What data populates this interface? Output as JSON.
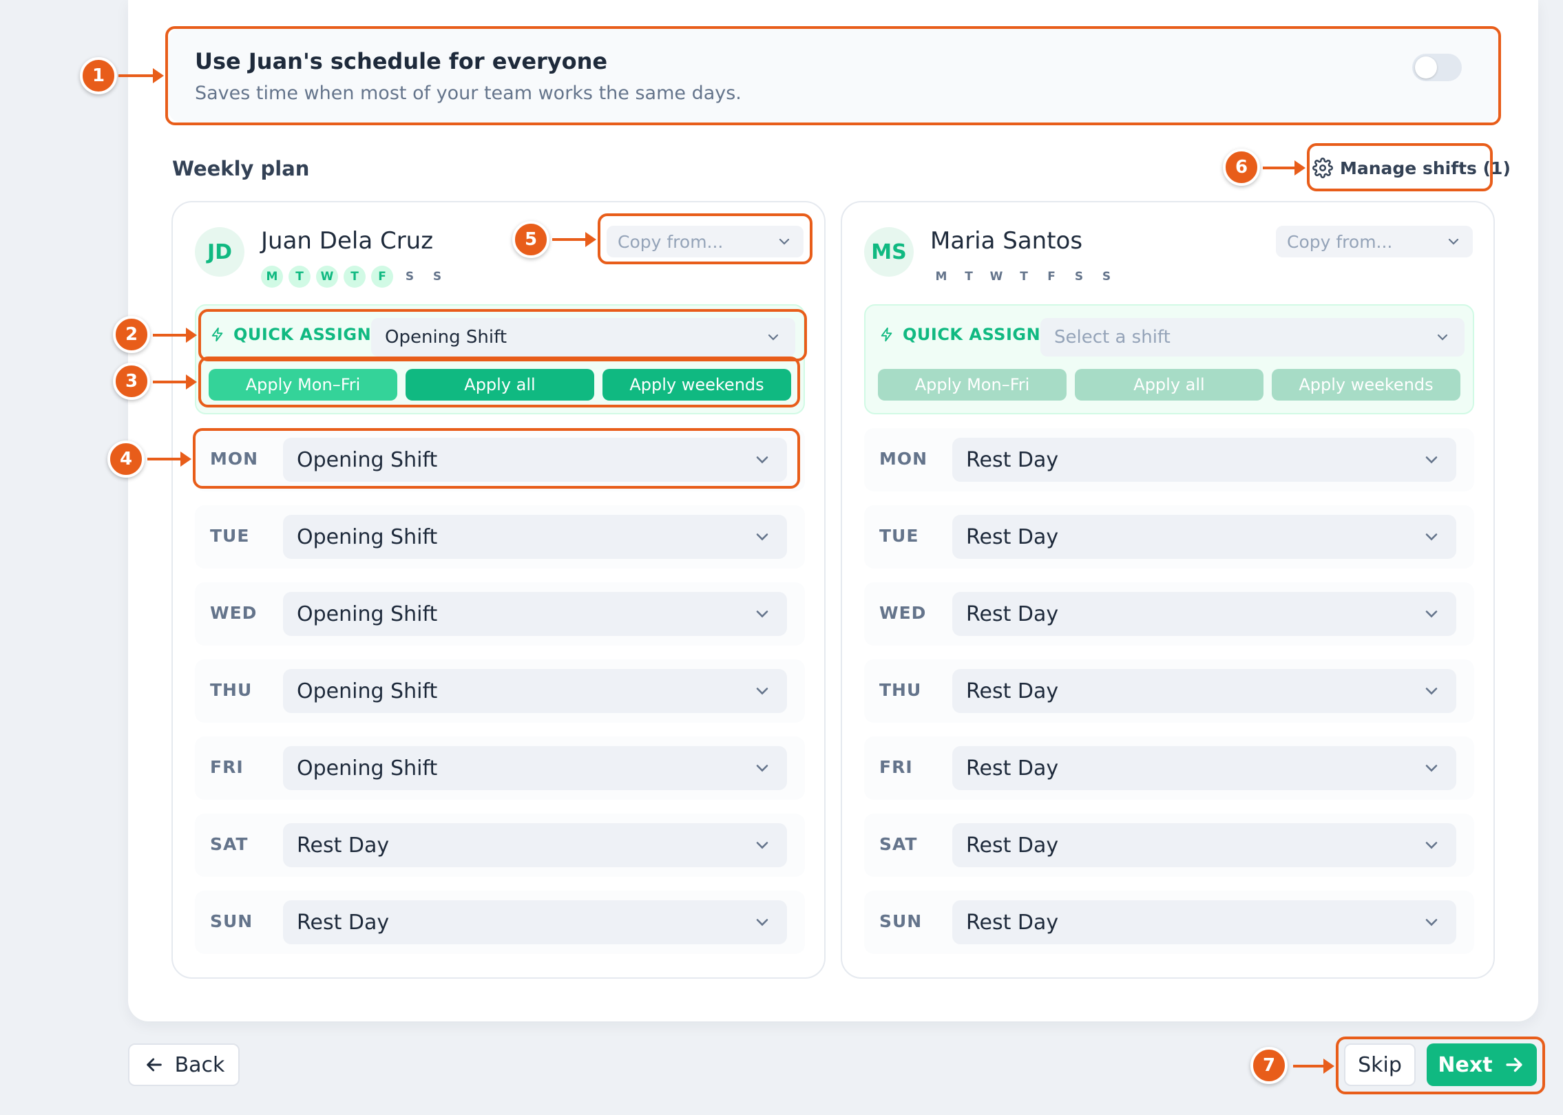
{
  "toggle_section": {
    "title": "Use Juan's schedule for everyone",
    "subtitle": "Saves time when most of your team works the same days.",
    "enabled": false
  },
  "weekly_plan": {
    "title": "Weekly plan",
    "manage_shifts_label": "Manage shifts (1)"
  },
  "employees": [
    {
      "initials": "JD",
      "name": "Juan Dela Cruz",
      "week_days": [
        "M",
        "T",
        "W",
        "T",
        "F",
        "S",
        "S"
      ],
      "copy_from_placeholder": "Copy from...",
      "quick_assign": {
        "label": "QUICK ASSIGN",
        "selected": "Opening Shift",
        "buttons": [
          "Apply Mon–Fri",
          "Apply all",
          "Apply weekends"
        ]
      },
      "schedule": [
        {
          "day": "MON",
          "shift": "Opening Shift"
        },
        {
          "day": "TUE",
          "shift": "Opening Shift"
        },
        {
          "day": "WED",
          "shift": "Opening Shift"
        },
        {
          "day": "THU",
          "shift": "Opening Shift"
        },
        {
          "day": "FRI",
          "shift": "Opening Shift"
        },
        {
          "day": "SAT",
          "shift": "Rest Day"
        },
        {
          "day": "SUN",
          "shift": "Rest Day"
        }
      ]
    },
    {
      "initials": "MS",
      "name": "Maria Santos",
      "week_days": [
        "M",
        "T",
        "W",
        "T",
        "F",
        "S",
        "S"
      ],
      "copy_from_placeholder": "Copy from...",
      "quick_assign": {
        "label": "QUICK ASSIGN",
        "placeholder": "Select a shift",
        "buttons": [
          "Apply Mon–Fri",
          "Apply all",
          "Apply weekends"
        ]
      },
      "schedule": [
        {
          "day": "MON",
          "shift": "Rest Day"
        },
        {
          "day": "TUE",
          "shift": "Rest Day"
        },
        {
          "day": "WED",
          "shift": "Rest Day"
        },
        {
          "day": "THU",
          "shift": "Rest Day"
        },
        {
          "day": "FRI",
          "shift": "Rest Day"
        },
        {
          "day": "SAT",
          "shift": "Rest Day"
        },
        {
          "day": "SUN",
          "shift": "Rest Day"
        }
      ]
    }
  ],
  "footer": {
    "back_label": "Back",
    "skip_label": "Skip",
    "next_label": "Next"
  },
  "annotations": [
    "1",
    "2",
    "3",
    "4",
    "5",
    "6",
    "7"
  ],
  "colors": {
    "accent": "#10b981",
    "annotation": "#e85d1a"
  }
}
